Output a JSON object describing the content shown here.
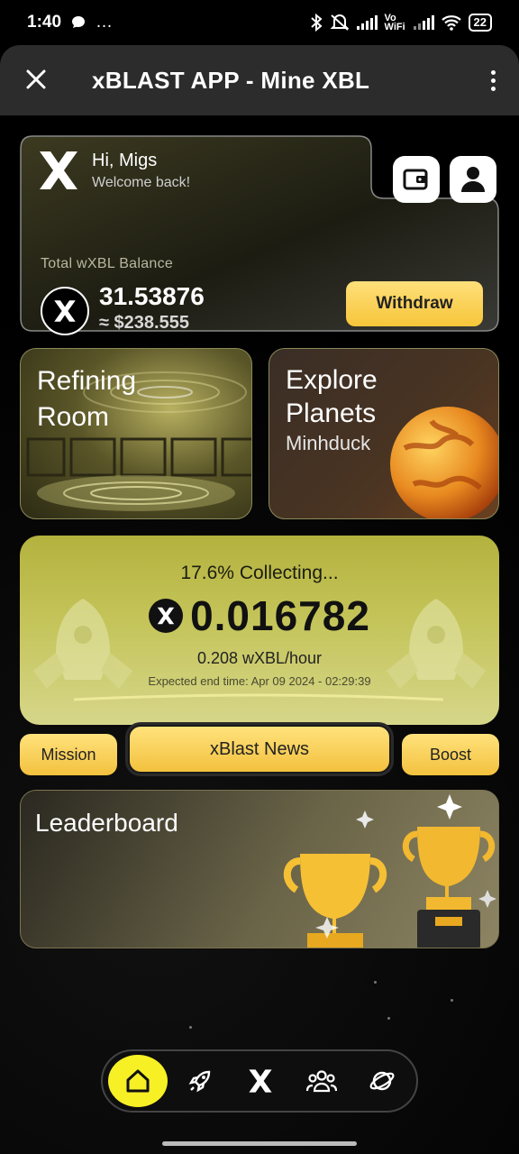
{
  "status_bar": {
    "time": "1:40",
    "notif_icon": "chat-bubble-icon",
    "more": "…",
    "network": "Vo WiFi",
    "battery": "22"
  },
  "app_bar": {
    "title": "xBLAST APP - Mine XBL",
    "close_icon": "close-icon",
    "menu_icon": "more-vert-icon"
  },
  "greeting": {
    "hello": "Hi, Migs",
    "welcome": "Welcome back!"
  },
  "balance": {
    "label": "Total wXBL Balance",
    "amount": "31.53876",
    "usd": "≈ $238.555",
    "withdraw_label": "Withdraw"
  },
  "tiles": {
    "refining": "Refining Room",
    "explore_title": "Explore Planets",
    "explore_sub": "Minhduck"
  },
  "collecting": {
    "progress_text": "17.6% Collecting...",
    "progress": 0.176,
    "amount": "0.016782",
    "rate": "0.208 wXBL/hour",
    "end_time": "Expected end time: Apr 09 2024 - 02:29:39"
  },
  "actions": {
    "mission": "Mission",
    "news": "xBlast News",
    "boost": "Boost"
  },
  "leaderboard": {
    "title": "Leaderboard"
  },
  "bottom_nav": {
    "items": [
      {
        "icon": "home-icon",
        "active": true
      },
      {
        "icon": "rocket-icon",
        "active": false
      },
      {
        "icon": "xblast-logo-icon",
        "active": false
      },
      {
        "icon": "users-icon",
        "active": false
      },
      {
        "icon": "planet-icon",
        "active": false
      }
    ]
  },
  "colors": {
    "accent_yellow": "#f6c53a",
    "nav_active": "#f6f025",
    "card_olive": "#c4c45a"
  }
}
